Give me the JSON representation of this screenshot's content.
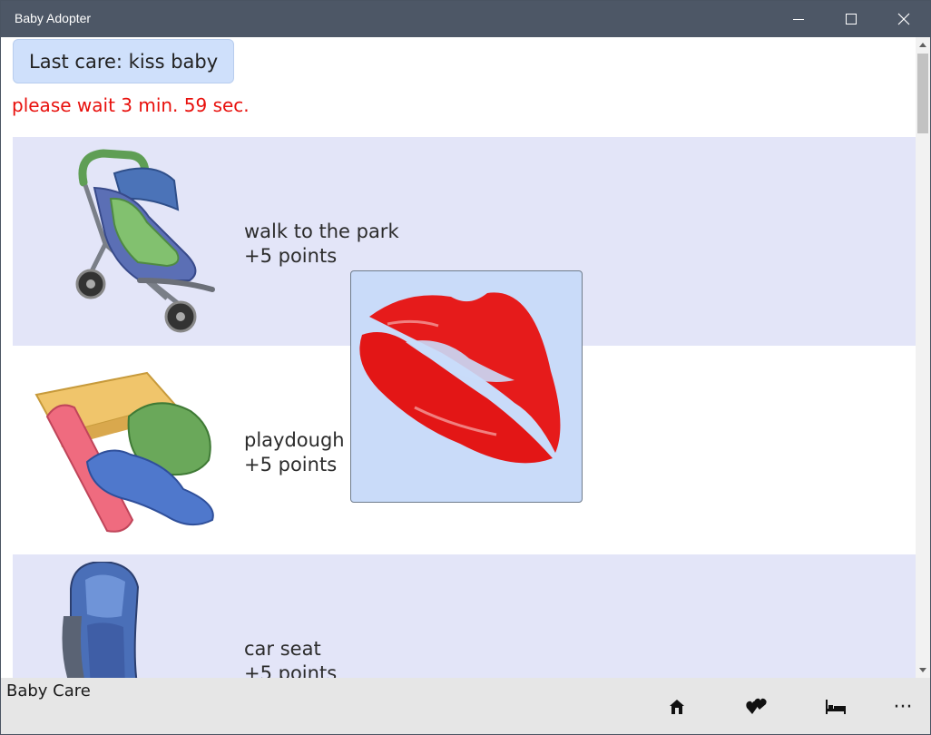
{
  "window": {
    "title": "Baby Adopter"
  },
  "status": {
    "last_care": "Last care: kiss baby",
    "wait_message": "please wait 3 min. 59 sec."
  },
  "care_items": [
    {
      "name": "walk to the park",
      "points": "+5 points",
      "icon": "stroller-icon"
    },
    {
      "name": "playdough",
      "points": "+5 points",
      "icon": "playdough-icon"
    },
    {
      "name": "car seat",
      "points": "+5 points",
      "icon": "car-seat-icon"
    }
  ],
  "overlay": {
    "icon": "kiss-lips-icon"
  },
  "command_bar": {
    "label": "Baby Care",
    "more_label": "···",
    "buttons": [
      "home-icon",
      "hearts-icon",
      "bed-icon"
    ]
  },
  "colors": {
    "titlebar": "#4d5766",
    "row_alt": "#e3e5f8",
    "badge": "#cfe0fb",
    "wait_text": "#e8100c",
    "command_bar": "#e6e6e6"
  }
}
